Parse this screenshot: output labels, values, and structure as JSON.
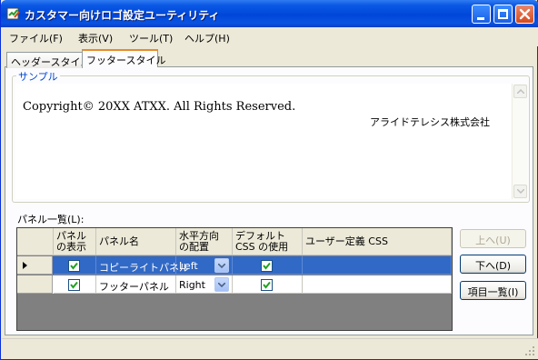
{
  "window": {
    "title": "カスタマー向けロゴ設定ユーティリティ"
  },
  "menu": [
    "ファイル(F)",
    "表示(V)",
    "ツール(T)",
    "ヘルプ(H)"
  ],
  "tabs": [
    {
      "label": "ヘッダースタイル",
      "selected": false
    },
    {
      "label": "フッタースタイル",
      "selected": true
    }
  ],
  "sample": {
    "label": "サンプル",
    "copyright": "Copyright© 20XX ATXX. All Rights Reserved.",
    "company": "アライドテレシス株式会社"
  },
  "panel_list": {
    "label": "パネル一覧(L):",
    "columns": [
      "パネルの表示",
      "パネル名",
      "水平方向の配置",
      "デフォルトCSS の使用",
      "ユーザー定義 CSS"
    ],
    "column_lines": [
      [
        "パネル",
        "の表示"
      ],
      [
        "パネル名"
      ],
      [
        "水平方向",
        "の配置"
      ],
      [
        "デフォルト",
        "CSS の使用"
      ],
      [
        "ユーザー定義 CSS"
      ]
    ],
    "rows": [
      {
        "show": true,
        "name": "コピーライトパネル",
        "align": "Left",
        "default_css": true,
        "user_css": "",
        "selected": true
      },
      {
        "show": true,
        "name": "フッターパネル",
        "align": "Right",
        "default_css": true,
        "user_css": "",
        "selected": false
      }
    ]
  },
  "buttons": {
    "up": "上へ(U)",
    "down": "下へ(D)",
    "list": "項目一覧(I)"
  },
  "colors": {
    "titlebar": "#0a58e4",
    "selection": "#3169c6",
    "groupbox_label": "#0046d5"
  }
}
